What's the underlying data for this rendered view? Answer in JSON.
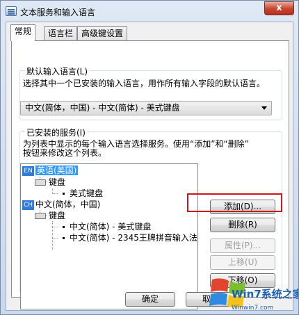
{
  "window": {
    "title": "文本服务和输入语言",
    "close_label": "x"
  },
  "tabs": [
    {
      "label": "常规",
      "active": true
    },
    {
      "label": "语言栏",
      "active": false
    },
    {
      "label": "高级键设置",
      "active": false
    }
  ],
  "default_language": {
    "group_label": "默认输入语言(L)",
    "description": "选择其中一个已安装的输入语言，用作所有输入字段的默认语言。",
    "selected": "中文(简体，中国) - 中文(简体) - 美式键盘"
  },
  "installed_services": {
    "group_label": "已安装的服务(I)",
    "description_line1": "为列表中显示的每个输入语言选择服务。使用“添加”和“删除”",
    "description_line2": "按钮来修改这个列表。",
    "tree": {
      "lang1": {
        "badge": "EN",
        "label": "英语(美国)"
      },
      "lang1_keyboard": "键盘",
      "lang1_kb1": "美式键盘",
      "lang2": {
        "badge": "CH",
        "label": "中文(简体，中国)"
      },
      "lang2_keyboard": "键盘",
      "lang2_kb1": "中文(简体) - 美式键盘",
      "lang2_kb2": "中文(简体) - 2345王牌拼音输入法"
    },
    "buttons": {
      "add": "添加(D)...",
      "remove": "删除(R)",
      "properties": "属性(P)...",
      "move_up": "上移(U)",
      "move_down": "下移(O)"
    }
  },
  "footer": {
    "ok": "确定",
    "cancel": "取消"
  },
  "watermark": {
    "text": "Win7系统之家",
    "url": "Winwin7.com"
  },
  "colors": {
    "highlight": "#c8191e",
    "selection": "#3399ff",
    "badge": "#2f7bd6"
  }
}
